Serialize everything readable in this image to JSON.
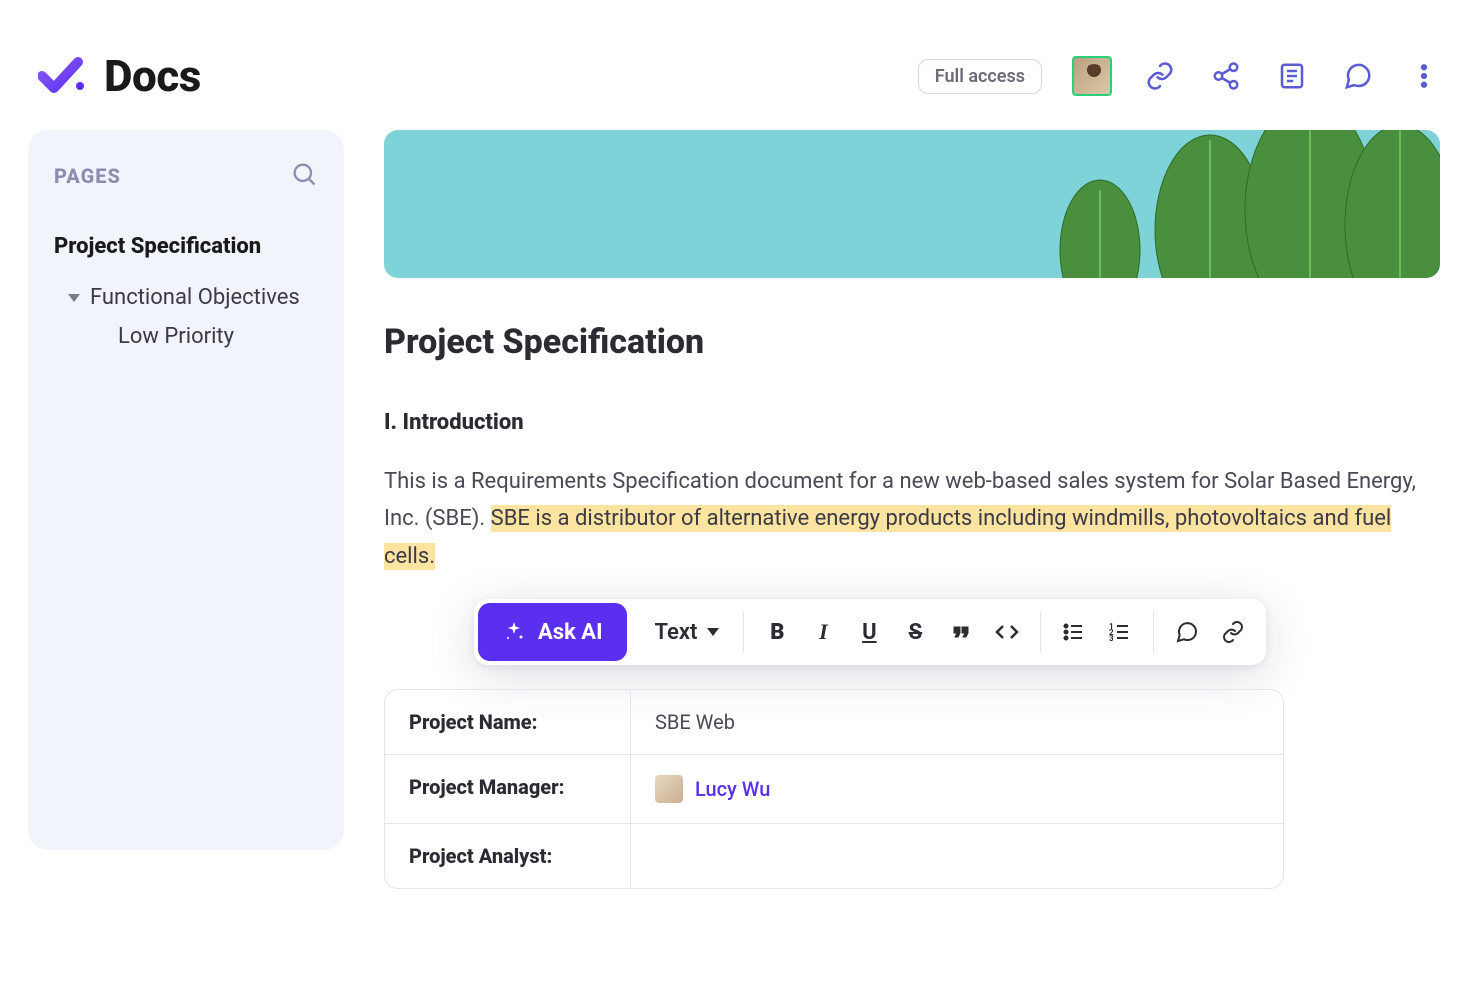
{
  "header": {
    "app_title": "Docs",
    "access_label": "Full access"
  },
  "sidebar": {
    "section_label": "PAGES",
    "items": [
      {
        "label": "Project Specification",
        "active": true
      },
      {
        "label": "Functional Objectives"
      },
      {
        "label": "Low Priority"
      }
    ]
  },
  "doc": {
    "title": "Project Specification",
    "section_heading": "I. Introduction",
    "intro_plain": "This is a Requirements Specification document for a new web-based sales system for Solar Based Energy, Inc. (SBE). ",
    "intro_highlighted": "SBE is a distributor of alternative energy products including windmills, photovoltaics and fuel cells."
  },
  "toolbar": {
    "ask_ai_label": "Ask AI",
    "text_label": "Text"
  },
  "table": {
    "rows": [
      {
        "key": "Project Name:",
        "value": "SBE Web"
      },
      {
        "key": "Project Manager:",
        "user": "Lucy Wu"
      },
      {
        "key": "Project Analyst:",
        "value": ""
      }
    ]
  }
}
